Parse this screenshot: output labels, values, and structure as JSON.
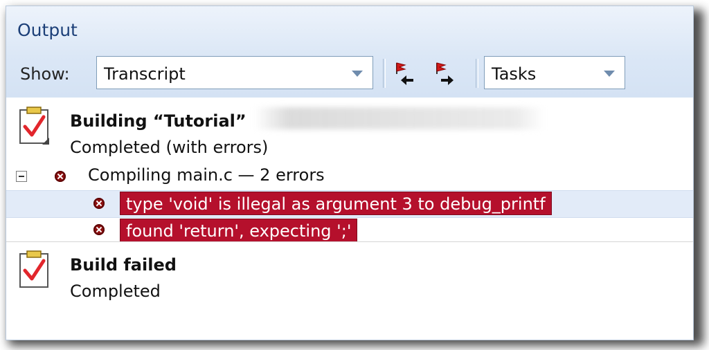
{
  "panel": {
    "title": "Output"
  },
  "toolbar": {
    "show_label": "Show:",
    "show_value": "Transcript",
    "tasks_value": "Tasks",
    "prev_error_icon": "previous-error-flag-icon",
    "next_error_icon": "next-error-flag-icon"
  },
  "entries": [
    {
      "title": "Building “Tutorial”",
      "status": "Completed (with errors)"
    },
    {
      "title": "Build failed",
      "status": "Completed"
    }
  ],
  "compile_group": {
    "label": "Compiling main.c — 2 errors",
    "errors": [
      "type 'void' is illegal as argument 3 to debug_printf",
      "found 'return', expecting ';'"
    ]
  },
  "colors": {
    "error_highlight": "#b5102c",
    "header_accent": "#1c3f78",
    "selected_row": "#e2ebf8"
  }
}
